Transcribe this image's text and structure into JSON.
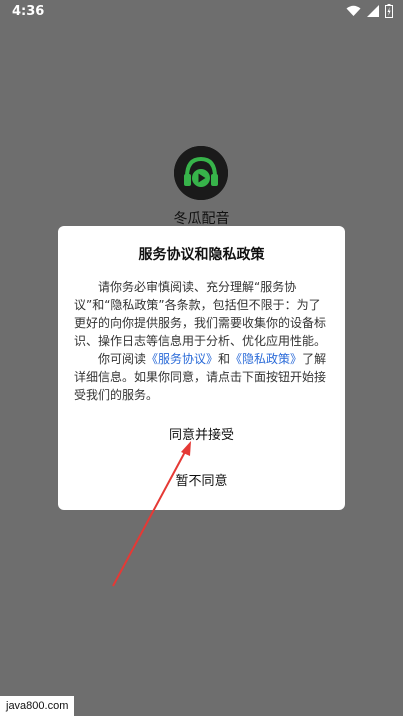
{
  "status_bar": {
    "time": "4:36"
  },
  "app": {
    "name": "冬瓜配音"
  },
  "dialog": {
    "title": "服务协议和隐私政策",
    "para1": "请你务必审慎阅读、充分理解“服务协议”和“隐私政策”各条款，包括但不限于：为了更好的向你提供服务，我们需要收集你的设备标识、操作日志等信息用于分析、优化应用性能。",
    "para2_prefix": "你可阅读",
    "link_service": "《服务协议》",
    "para2_and": "和",
    "link_privacy": "《隐私政策》",
    "para2_suffix": "了解详细信息。如果你同意，请点击下面按钮开始接受我们的服务。",
    "accept": "同意并接受",
    "decline": "暂不同意"
  },
  "watermark": {
    "text": "java800.com"
  },
  "colors": {
    "overlay": "#6e6e6e",
    "link": "#2b6bd8",
    "arrow": "#e53935",
    "logo_green": "#37b34a"
  }
}
